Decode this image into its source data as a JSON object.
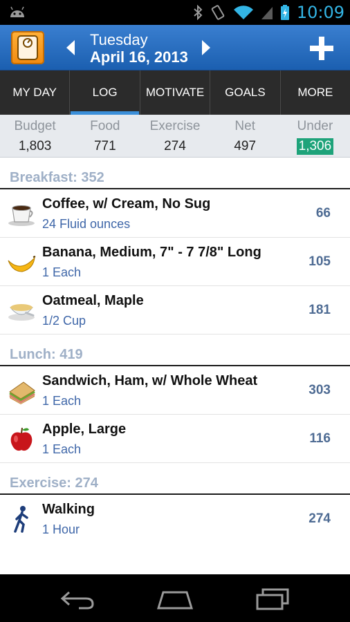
{
  "status_bar": {
    "time": "10:09",
    "icons": [
      "android-icon",
      "bluetooth-icon",
      "vibrate-icon",
      "wifi-icon",
      "signal-icon",
      "battery-icon"
    ]
  },
  "header": {
    "day": "Tuesday",
    "date": "April 16, 2013",
    "add_label": "+"
  },
  "tabs": [
    {
      "label": "MY DAY",
      "active": false
    },
    {
      "label": "LOG",
      "active": true
    },
    {
      "label": "MOTIVATE",
      "active": false
    },
    {
      "label": "GOALS",
      "active": false
    },
    {
      "label": "MORE",
      "active": false
    }
  ],
  "summary": [
    {
      "label": "Budget",
      "value": "1,803"
    },
    {
      "label": "Food",
      "value": "771"
    },
    {
      "label": "Exercise",
      "value": "274"
    },
    {
      "label": "Net",
      "value": "497"
    },
    {
      "label": "Under",
      "value": "1,306",
      "highlight": "#1ea37a"
    }
  ],
  "sections": {
    "breakfast": {
      "title": "Breakfast: 352",
      "items": [
        {
          "name": "Coffee, w/ Cream, No Sug",
          "amount": "24 Fluid ounces",
          "calories": "66",
          "icon": "coffee-cup-icon"
        },
        {
          "name": "Banana, Medium, 7\" - 7 7/8\" Long",
          "amount": "1 Each",
          "calories": "105",
          "icon": "banana-icon"
        },
        {
          "name": "Oatmeal, Maple",
          "amount": "1/2 Cup",
          "calories": "181",
          "icon": "oatmeal-bowl-icon"
        }
      ]
    },
    "lunch": {
      "title": "Lunch: 419",
      "items": [
        {
          "name": "Sandwich, Ham, w/ Whole Wheat",
          "amount": "1 Each",
          "calories": "303",
          "icon": "sandwich-icon"
        },
        {
          "name": "Apple, Large",
          "amount": "1 Each",
          "calories": "116",
          "icon": "apple-icon"
        }
      ]
    },
    "exercise": {
      "title": "Exercise: 274",
      "items": [
        {
          "name": "Walking",
          "amount": "1 Hour",
          "calories": "274",
          "icon": "walking-person-icon"
        }
      ]
    }
  },
  "colors": {
    "header_blue": "#2a6fc2",
    "tab_active": "#3b8fd9",
    "under_green": "#1ea37a",
    "section_title": "#9fb0c7",
    "amount_blue": "#3e66a8"
  }
}
